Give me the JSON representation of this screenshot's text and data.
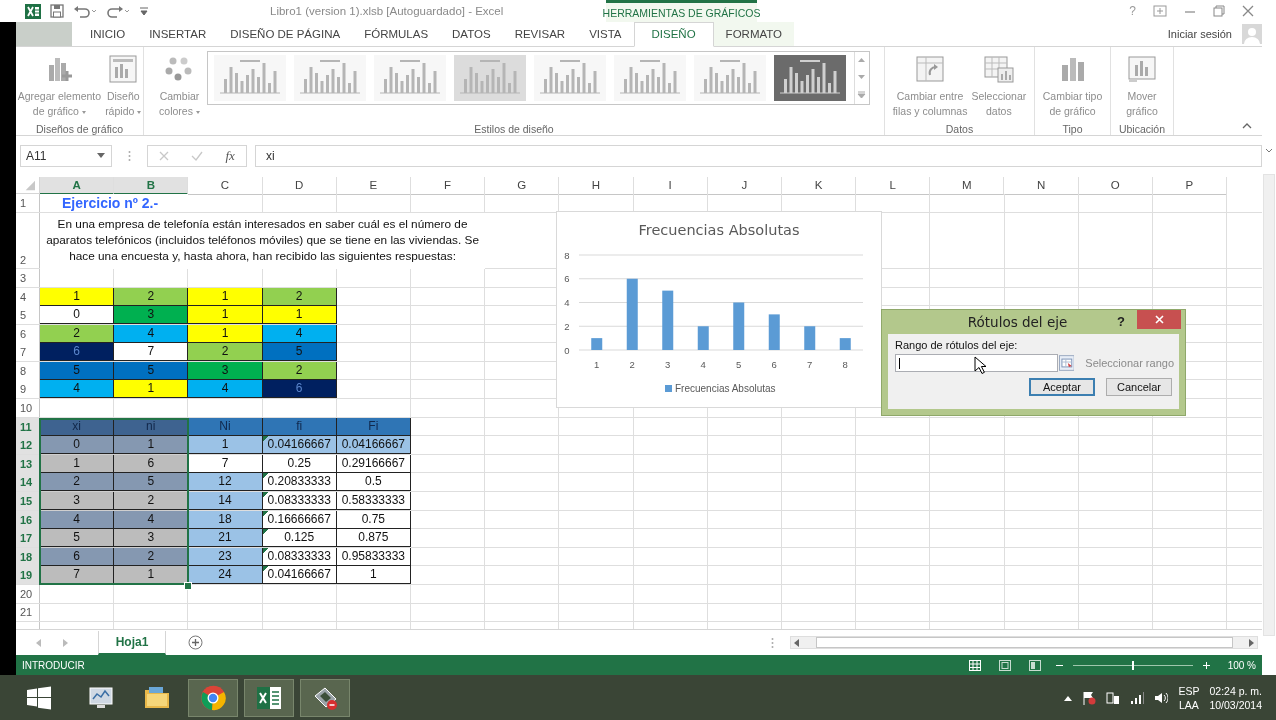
{
  "title_bar": {
    "document_title": "Libro1 (version 1).xlsb [Autoguardado] - Excel",
    "context_label": "HERRAMIENTAS DE GRÁFICOS",
    "help": "?"
  },
  "tabs": [
    {
      "label": "INICIO",
      "selected": false
    },
    {
      "label": "INSERTAR",
      "selected": false
    },
    {
      "label": "DISEÑO DE PÁGINA",
      "selected": false
    },
    {
      "label": "FÓRMULAS",
      "selected": false
    },
    {
      "label": "DATOS",
      "selected": false
    },
    {
      "label": "REVISAR",
      "selected": false
    },
    {
      "label": "VISTA",
      "selected": false
    },
    {
      "label": "DISEÑO",
      "selected": true,
      "contextual": true
    },
    {
      "label": "FORMATO",
      "selected": false,
      "contextual": true
    }
  ],
  "account": {
    "label": "Iniciar sesión"
  },
  "ribbon": {
    "disabled": true,
    "groups": [
      {
        "label": "Diseños de gráfico",
        "commands": [
          {
            "kind": "add-element",
            "lines": [
              "Agregar elemento",
              "de gráfico"
            ],
            "dropdown": true
          },
          {
            "kind": "quick-layout",
            "lines": [
              "Diseño",
              "rápido"
            ],
            "dropdown": true
          }
        ]
      },
      {
        "label": "Estilos de diseño",
        "commands": [
          {
            "kind": "colors",
            "lines": [
              "Cambiar",
              "colores"
            ],
            "dropdown": true
          }
        ],
        "styles": [
          {
            "kind": "light"
          },
          {
            "kind": "light"
          },
          {
            "kind": "light"
          },
          {
            "kind": "shaded"
          },
          {
            "kind": "light"
          },
          {
            "kind": "light"
          },
          {
            "kind": "light"
          },
          {
            "kind": "dark"
          }
        ]
      },
      {
        "label": "Datos",
        "commands": [
          {
            "kind": "switch",
            "lines": [
              "Cambiar entre",
              "filas y columnas"
            ],
            "dropdown": false
          },
          {
            "kind": "select-data",
            "lines": [
              "Seleccionar",
              "datos"
            ],
            "dropdown": false
          }
        ]
      },
      {
        "label": "Tipo",
        "commands": [
          {
            "kind": "chart-type",
            "lines": [
              "Cambiar tipo",
              "de gráfico"
            ],
            "dropdown": false
          }
        ]
      },
      {
        "label": "Ubicación",
        "commands": [
          {
            "kind": "move",
            "lines": [
              "Mover",
              "gráfico"
            ],
            "dropdown": false
          }
        ]
      }
    ]
  },
  "formula_bar": {
    "name_box": "A11",
    "function_button": "fx",
    "formula": "xi"
  },
  "sheet": {
    "columns": [
      {
        "label": "A",
        "selected": true
      },
      {
        "label": "B",
        "selected": true
      },
      {
        "label": "C",
        "selected": false
      },
      {
        "label": "D",
        "selected": false
      },
      {
        "label": "E",
        "selected": false
      },
      {
        "label": "F",
        "selected": false
      },
      {
        "label": "G",
        "selected": false
      },
      {
        "label": "H",
        "selected": false
      },
      {
        "label": "I",
        "selected": false
      },
      {
        "label": "J",
        "selected": false
      },
      {
        "label": "K",
        "selected": false
      },
      {
        "label": "L",
        "selected": false
      },
      {
        "label": "M",
        "selected": false
      },
      {
        "label": "N",
        "selected": false
      },
      {
        "label": "O",
        "selected": false
      },
      {
        "label": "P",
        "selected": false
      }
    ],
    "rows": [
      {
        "label": "1",
        "selected": false
      },
      {
        "label": "2",
        "selected": false
      },
      {
        "label": "3",
        "selected": false
      },
      {
        "label": "4",
        "selected": false
      },
      {
        "label": "5",
        "selected": false
      },
      {
        "label": "6",
        "selected": false
      },
      {
        "label": "7",
        "selected": false
      },
      {
        "label": "8",
        "selected": false
      },
      {
        "label": "9",
        "selected": false
      },
      {
        "label": "10",
        "selected": false
      },
      {
        "label": "11",
        "selected": true
      },
      {
        "label": "12",
        "selected": true
      },
      {
        "label": "13",
        "selected": true
      },
      {
        "label": "14",
        "selected": true
      },
      {
        "label": "15",
        "selected": true
      },
      {
        "label": "16",
        "selected": true
      },
      {
        "label": "17",
        "selected": true
      },
      {
        "label": "18",
        "selected": true
      },
      {
        "label": "19",
        "selected": true
      },
      {
        "label": "20",
        "selected": false
      },
      {
        "label": "21",
        "selected": false
      }
    ],
    "title": "Ejercicio nº 2.-",
    "statement": "En una empresa de telefonía están interesados en saber cuál es el número de aparatos telefónicos (incluidos teléfonos móviles) que se tiene en las viviendas. Se hace una encuesta y, hasta ahora, han recibido las siguientes respuestas:",
    "responses": [
      [
        {
          "value": "1",
          "color": "#ffff00"
        },
        {
          "value": "2",
          "color": "#92d050"
        },
        {
          "value": "1",
          "color": "#ffff00"
        },
        {
          "value": "2",
          "color": "#92d050"
        }
      ],
      [
        {
          "value": "0",
          "color": "#ffffff"
        },
        {
          "value": "3",
          "color": "#00b050"
        },
        {
          "value": "1",
          "color": "#ffff00"
        },
        {
          "value": "1",
          "color": "#ffff00"
        }
      ],
      [
        {
          "value": "2",
          "color": "#92d050"
        },
        {
          "value": "4",
          "color": "#00b0f0"
        },
        {
          "value": "1",
          "color": "#ffff00"
        },
        {
          "value": "4",
          "color": "#00b0f0"
        }
      ],
      [
        {
          "value": "6",
          "color": "#002060"
        },
        {
          "value": "7",
          "color": "#ffffff"
        },
        {
          "value": "2",
          "color": "#92d050"
        },
        {
          "value": "5",
          "color": "#0070c0"
        }
      ],
      [
        {
          "value": "5",
          "color": "#0070c0"
        },
        {
          "value": "5",
          "color": "#0070c0"
        },
        {
          "value": "3",
          "color": "#00b050"
        },
        {
          "value": "2",
          "color": "#92d050"
        }
      ],
      [
        {
          "value": "4",
          "color": "#00b0f0"
        },
        {
          "value": "1",
          "color": "#ffff00"
        },
        {
          "value": "4",
          "color": "#00b0f0"
        },
        {
          "value": "6",
          "color": "#002060"
        }
      ]
    ],
    "frequency_table": {
      "header": [
        {
          "text": "xi",
          "color": "#41699a"
        },
        {
          "text": "ni",
          "color": "#41699a"
        },
        {
          "text": "Ni",
          "color": "#2f75b5"
        },
        {
          "text": "fi",
          "color": "#2f75b5"
        },
        {
          "text": "Fi",
          "color": "#2f75b5"
        }
      ],
      "rows": [
        {
          "flagged": true,
          "cells": [
            {
              "text": "0",
              "color": "#8ea2bd"
            },
            {
              "text": "1",
              "color": "#8ea2bd"
            },
            {
              "text": "1",
              "color": "#9bc2e6"
            },
            {
              "text": "0.04166667",
              "color": "#9bc2e6"
            },
            {
              "text": "0.04166667",
              "color": "#9bc2e6"
            }
          ]
        },
        {
          "flagged": false,
          "cells": [
            {
              "text": "1",
              "color": "#c9c9c9"
            },
            {
              "text": "6",
              "color": "#c9c9c9"
            },
            {
              "text": "7",
              "color": "#ffffff"
            },
            {
              "text": "0.25",
              "color": "#ffffff"
            },
            {
              "text": "0.29166667",
              "color": "#ffffff"
            }
          ]
        },
        {
          "flagged": true,
          "cells": [
            {
              "text": "2",
              "color": "#8ea2bd"
            },
            {
              "text": "5",
              "color": "#8ea2bd"
            },
            {
              "text": "12",
              "color": "#9bc2e6"
            },
            {
              "text": "0.20833333",
              "color": "#ffffff"
            },
            {
              "text": "0.5",
              "color": "#ffffff"
            }
          ]
        },
        {
          "flagged": true,
          "cells": [
            {
              "text": "3",
              "color": "#c9c9c9"
            },
            {
              "text": "2",
              "color": "#c9c9c9"
            },
            {
              "text": "14",
              "color": "#9bc2e6"
            },
            {
              "text": "0.08333333",
              "color": "#ffffff"
            },
            {
              "text": "0.58333333",
              "color": "#ffffff"
            }
          ]
        },
        {
          "flagged": true,
          "cells": [
            {
              "text": "4",
              "color": "#8ea2bd"
            },
            {
              "text": "4",
              "color": "#8ea2bd"
            },
            {
              "text": "18",
              "color": "#9bc2e6"
            },
            {
              "text": "0.16666667",
              "color": "#ffffff"
            },
            {
              "text": "0.75",
              "color": "#ffffff"
            }
          ]
        },
        {
          "flagged": true,
          "cells": [
            {
              "text": "5",
              "color": "#c9c9c9"
            },
            {
              "text": "3",
              "color": "#c9c9c9"
            },
            {
              "text": "21",
              "color": "#9bc2e6"
            },
            {
              "text": "0.125",
              "color": "#ffffff"
            },
            {
              "text": "0.875",
              "color": "#ffffff"
            }
          ]
        },
        {
          "flagged": true,
          "cells": [
            {
              "text": "6",
              "color": "#8ea2bd"
            },
            {
              "text": "2",
              "color": "#8ea2bd"
            },
            {
              "text": "23",
              "color": "#9bc2e6"
            },
            {
              "text": "0.08333333",
              "color": "#ffffff"
            },
            {
              "text": "0.95833333",
              "color": "#ffffff"
            }
          ]
        },
        {
          "flagged": true,
          "cells": [
            {
              "text": "7",
              "color": "#c9c9c9"
            },
            {
              "text": "1",
              "color": "#c9c9c9"
            },
            {
              "text": "24",
              "color": "#9bc2e6"
            },
            {
              "text": "0.04166667",
              "color": "#ffffff"
            },
            {
              "text": "1",
              "color": "#ffffff"
            }
          ]
        }
      ]
    }
  },
  "chart": {
    "chart_data": {
      "type": "bar",
      "title": "Frecuencias Absolutas",
      "categories": [
        "1",
        "2",
        "3",
        "4",
        "5",
        "6",
        "7",
        "8"
      ],
      "series": [
        {
          "name": "Frecuencias Absolutas",
          "color": "#5b9bd5",
          "values": [
            1,
            6,
            5,
            2,
            4,
            3,
            2,
            1
          ]
        }
      ],
      "ylim": [
        0,
        8
      ],
      "yticks": [
        0,
        2,
        4,
        6,
        8
      ],
      "grid": true
    }
  },
  "dialog": {
    "title": "Rótulos del eje",
    "help": "?",
    "field_label": "Rango de rótulos del eje:",
    "range_hint": "Seleccionar rango",
    "buttons": [
      {
        "label": "Aceptar",
        "default": true
      },
      {
        "label": "Cancelar",
        "default": false
      }
    ]
  },
  "sheet_tabs": [
    {
      "label": "Hoja1",
      "selected": true
    }
  ],
  "status_bar": {
    "mode": "INTRODUCIR",
    "views": [
      {
        "kind": "normal",
        "selected": true
      },
      {
        "kind": "page-layout",
        "selected": false
      },
      {
        "kind": "page-break",
        "selected": false
      }
    ],
    "zoom_slider": {
      "level": 0.5
    },
    "zoom": "100 %"
  },
  "taskbar": {
    "apps": [
      {
        "kind": "monitor",
        "running": false
      },
      {
        "kind": "folder",
        "running": false
      },
      {
        "kind": "browser",
        "running": true
      },
      {
        "kind": "excel",
        "running": true
      },
      {
        "kind": "tool",
        "running": true
      }
    ],
    "language": "ESP",
    "layout": "LAA",
    "time": "02:24 p. m.",
    "date": "10/03/2014"
  }
}
